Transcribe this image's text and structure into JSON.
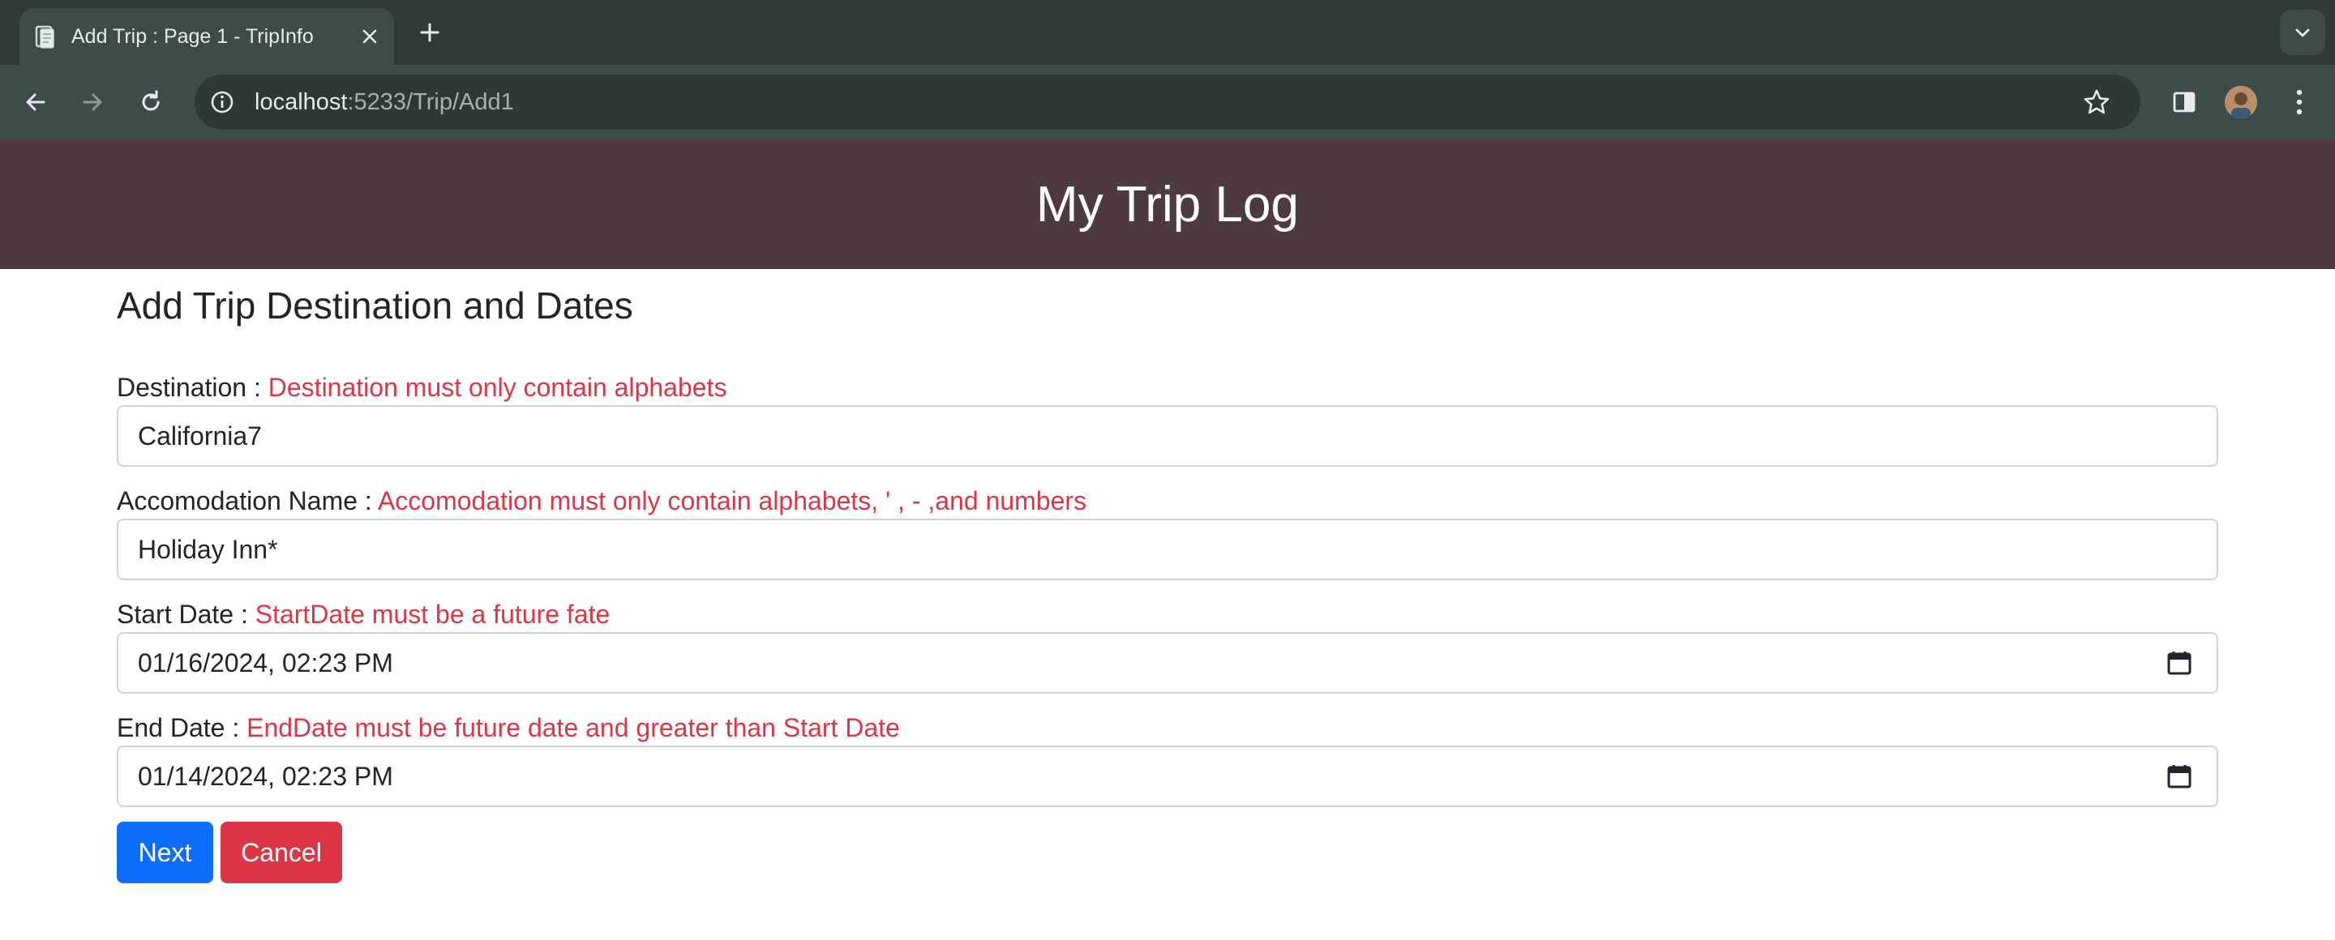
{
  "browser": {
    "tab_title": "Add Trip : Page 1 - TripInfo",
    "url_host": "localhost",
    "url_path": ":5233/Trip/Add1",
    "icons": [
      "file-icon",
      "close-icon",
      "plus-icon",
      "chevron-down-icon",
      "back-arrow-icon",
      "forward-arrow-icon",
      "reload-icon",
      "info-icon",
      "star-icon",
      "side-panel-icon",
      "avatar",
      "kebab-menu-icon"
    ]
  },
  "header": {
    "title": "My Trip Log",
    "background": "#4e3c3c"
  },
  "form": {
    "heading": "Add Trip Destination and Dates",
    "destination": {
      "label": "Destination : ",
      "error": "Destination must only contain alphabets",
      "value": "California7"
    },
    "accommodation": {
      "label": "Accomodation Name : ",
      "error": "Accomodation must only contain alphabets, ' , - ,and numbers",
      "value": "Holiday Inn*"
    },
    "start_date": {
      "label": "Start Date : ",
      "error": "StartDate must be a future fate",
      "value": "01/16/2024, 02:23 PM"
    },
    "end_date": {
      "label": "End Date : ",
      "error": "EndDate must be future date and greater than Start Date",
      "value": "01/14/2024, 02:23 PM"
    },
    "buttons": {
      "next": "Next",
      "cancel": "Cancel"
    }
  },
  "colors": {
    "error": "#dc3545",
    "primary": "#0d6efd",
    "danger": "#dc3545"
  }
}
